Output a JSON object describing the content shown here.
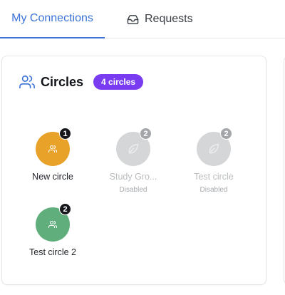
{
  "tabs": {
    "my_connections": "My Connections",
    "requests": "Requests"
  },
  "circles_card": {
    "title": "Circles",
    "count_badge": "4 circles"
  },
  "circles": [
    {
      "name": "New circle",
      "count": "1",
      "status": "",
      "color": "#e8a22a",
      "icon": "people-icon"
    },
    {
      "name": "Study Gro...",
      "count": "2",
      "status": "Disabled",
      "color": "#d5d6d8",
      "icon": "leaf-icon"
    },
    {
      "name": "Test circle",
      "count": "2",
      "status": "Disabled",
      "color": "#d5d6d8",
      "icon": "leaf-icon"
    },
    {
      "name": "Test circle 2",
      "count": "2",
      "status": "",
      "color": "#5fae7c",
      "icon": "people-icon"
    }
  ],
  "colors": {
    "accent": "#3b74d6",
    "badge_purple": "#7a3cf0"
  }
}
